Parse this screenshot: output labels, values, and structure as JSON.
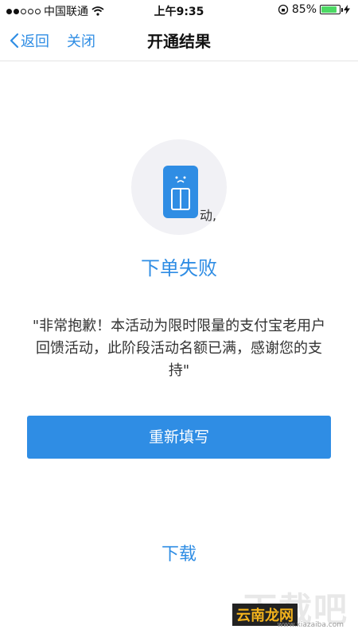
{
  "status_bar": {
    "carrier": "中国联通",
    "time": "上午9:35",
    "battery": "85%",
    "battery_level": 0.85
  },
  "nav": {
    "back_label": "返回",
    "close_label": "关闭",
    "title": "开通结果"
  },
  "illustration": {
    "icon": "sim-card-sad-icon",
    "caption": "动,"
  },
  "result": {
    "title": "下单失败",
    "message": "\"非常抱歉！本活动为限时限量的支付宝老用户回馈活动，此阶段活动名额已满，感谢您的支持\""
  },
  "actions": {
    "refill_label": "重新填写",
    "bottom_link": "下载"
  },
  "watermark": {
    "big_text": "下载吧",
    "logo_text": "云南龙网",
    "url": "www.xiazaiba.com"
  },
  "colors": {
    "accent": "#2f8de4",
    "battery_fill": "#4cd964"
  }
}
